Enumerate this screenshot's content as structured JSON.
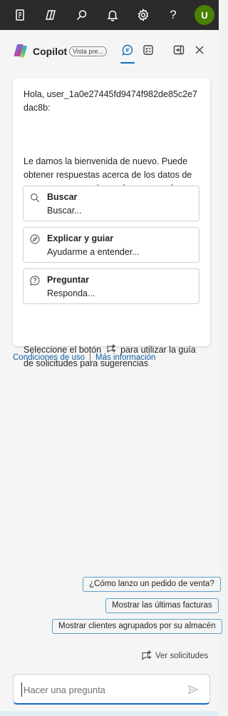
{
  "topbar": {
    "icons": [
      "document-icon",
      "copilot-icon",
      "search-icon",
      "bell-icon",
      "gear-icon",
      "help-icon"
    ],
    "help_label": "?",
    "avatar_initial": "U"
  },
  "copilot": {
    "title": "Copilot",
    "badge": "Vista pre...",
    "greeting": "Hola, user_1a0e27445fd9474f982de85c2e7dac8b:",
    "intro": "Le damos la bienvenida de nuevo. Puede obtener respuestas acerca de los datos de su empresa y ayuda con las tareas y la información.",
    "options": [
      {
        "title": "Buscar",
        "subtitle": "Buscar...",
        "icon": "search-icon"
      },
      {
        "title": "Explicar y guiar",
        "subtitle": "Ayudarme a entender...",
        "icon": "compass-icon"
      },
      {
        "title": "Preguntar",
        "subtitle": "Responda...",
        "icon": "question-chat-icon"
      }
    ],
    "hint_before": "Seleccione el botón",
    "hint_after": "para utilizar la guía de solicitudes para sugerencias",
    "links": {
      "terms": "Condiciones de uso",
      "separator": "|",
      "more_info": "Más información"
    },
    "suggestions": [
      "¿Cómo lanzo un pedido de venta?",
      "Mostrar las últimas facturas",
      "Mostrar clientes agrupados por su almacén"
    ],
    "view_requests": "Ver solicitudes",
    "input_placeholder": "Hacer una pregunta"
  },
  "colors": {
    "topbar": "#2b2b2b",
    "accent": "#0f6cbd",
    "avatar": "#498205",
    "suggestion_border": "#5d9fc9"
  }
}
